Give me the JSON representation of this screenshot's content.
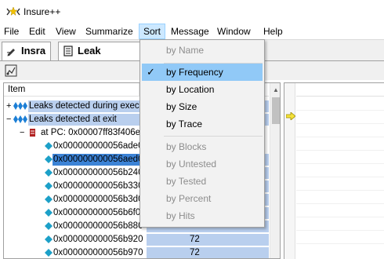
{
  "window": {
    "title": "Insure++"
  },
  "menubar": {
    "items": [
      "File",
      "Edit",
      "View",
      "Summarize",
      "Sort",
      "Message",
      "Window",
      "Help"
    ],
    "active": "Sort"
  },
  "tabs": [
    {
      "label": "Insra",
      "icon": "pencil-icon"
    },
    {
      "label": "Leak summa",
      "icon": "document-icon"
    }
  ],
  "toolbar": {
    "tool_icon": "pointer-tool-icon"
  },
  "tree": {
    "header": "Item",
    "rows": [
      {
        "expander": "+",
        "label": "Leaks detected during exec",
        "kind": "group"
      },
      {
        "expander": "−",
        "label": "Leaks detected at exit",
        "kind": "group"
      },
      {
        "expander": "−",
        "label": "at PC: 0x00007ff83f406e",
        "kind": "pc"
      },
      {
        "label": "0x000000000056ade0",
        "count": ""
      },
      {
        "label": "0x000000000056aed0",
        "count": ""
      },
      {
        "label": "0x000000000056b240",
        "count": ""
      },
      {
        "label": "0x000000000056b330",
        "count": ""
      },
      {
        "label": "0x000000000056b3d0",
        "count": ""
      },
      {
        "label": "0x000000000056b6f0",
        "count": ""
      },
      {
        "label": "0x000000000056b880",
        "count": ""
      },
      {
        "label": "0x000000000056b920",
        "count": "72"
      },
      {
        "label": "0x000000000056b970",
        "count": "72"
      }
    ]
  },
  "sort_menu": {
    "group1": [
      {
        "label": "by Name",
        "enabled": false
      }
    ],
    "group2": [
      {
        "label": "by Frequency",
        "enabled": true,
        "checked": true,
        "hovered": true
      },
      {
        "label": "by Location",
        "enabled": true
      },
      {
        "label": "by Size",
        "enabled": true
      },
      {
        "label": "by Trace",
        "enabled": true
      }
    ],
    "group3": [
      {
        "label": "by Blocks",
        "enabled": false
      },
      {
        "label": "by Untested",
        "enabled": false
      },
      {
        "label": "by Tested",
        "enabled": false
      },
      {
        "label": "by Percent",
        "enabled": false
      },
      {
        "label": "by Hits",
        "enabled": false
      }
    ],
    "check_glyph": "✓"
  },
  "colors": {
    "selection": "#b9cfee",
    "focus_selection": "#3c83d6",
    "menu_hover": "#91c9f7",
    "leak_icon": "#1c7fd6"
  }
}
